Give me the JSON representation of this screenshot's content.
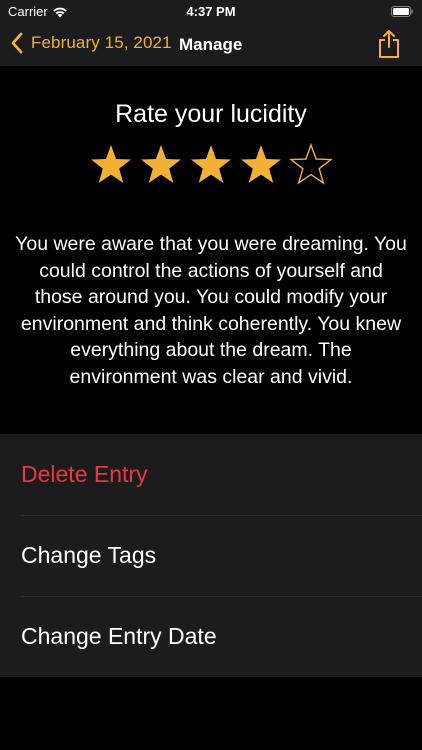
{
  "status_bar": {
    "carrier": "Carrier",
    "time": "4:37 PM"
  },
  "nav": {
    "back_label": "February 15, 2021",
    "title": "Manage"
  },
  "rating": {
    "title": "Rate your lucidity",
    "stars_total": 5,
    "stars_filled": 4,
    "star_color": "#f2b134",
    "description": "You were aware that you were dreaming. You could control the actions of yourself and those around you. You could modify your environment and think coherently. You knew everything about the dream. The environment was clear and vivid."
  },
  "actions": {
    "delete_label": "Delete Entry",
    "tags_label": "Change Tags",
    "date_label": "Change Entry Date"
  },
  "colors": {
    "accent": "#f2b134",
    "destructive": "#e5393b",
    "background": "#000000",
    "panel": "#1c1c1e"
  }
}
